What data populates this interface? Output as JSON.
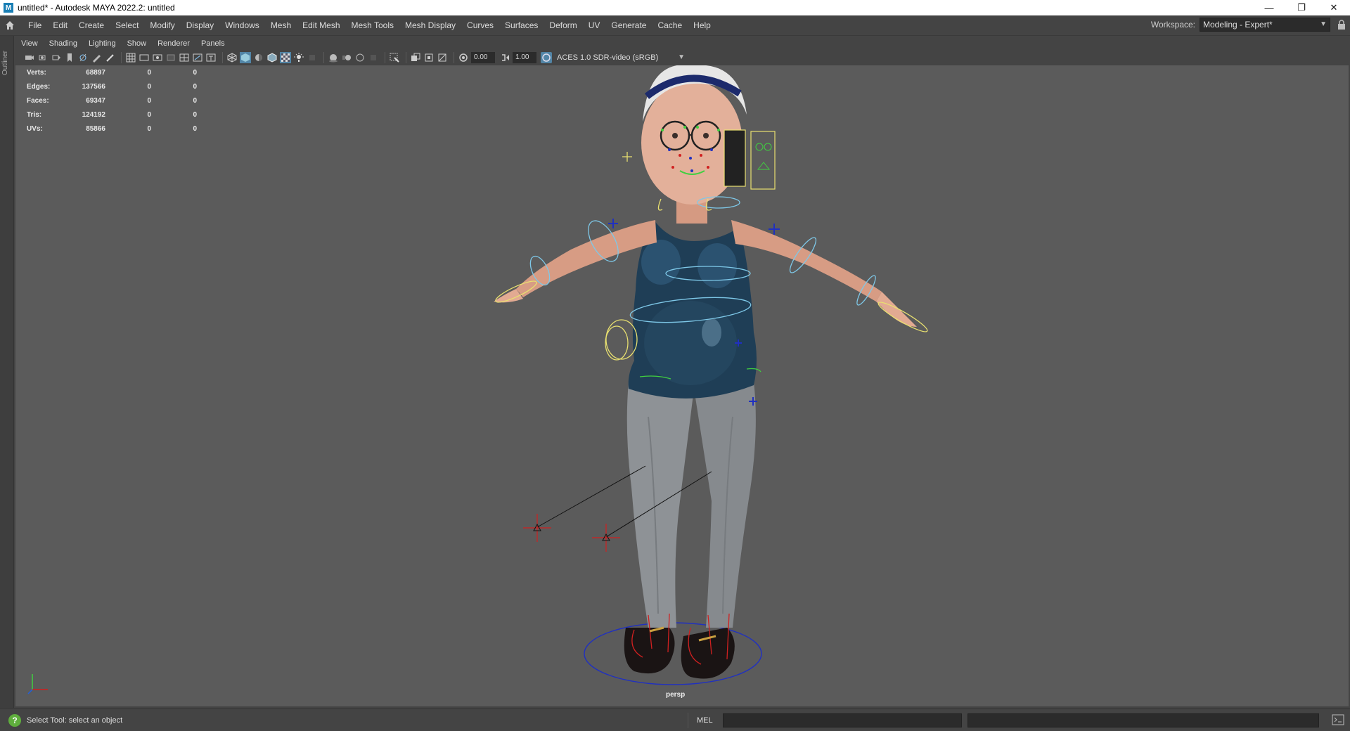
{
  "window": {
    "title": "untitled* - Autodesk MAYA 2022.2: untitled",
    "app_icon": "maya-icon",
    "controls": [
      "minimize-icon",
      "restore-icon",
      "close-icon"
    ]
  },
  "menubar": {
    "home_icon": "home-icon",
    "items": [
      "File",
      "Edit",
      "Create",
      "Select",
      "Modify",
      "Display",
      "Windows",
      "Mesh",
      "Edit Mesh",
      "Mesh Tools",
      "Mesh Display",
      "Curves",
      "Surfaces",
      "Deform",
      "UV",
      "Generate",
      "Cache",
      "Help"
    ],
    "workspace_label": "Workspace:",
    "workspace_value": "Modeling - Expert*"
  },
  "leftstrip": {
    "outliner_label": "Outliner"
  },
  "panel_menu": {
    "items": [
      "View",
      "Shading",
      "Lighting",
      "Show",
      "Renderer",
      "Panels"
    ]
  },
  "panel_toolbar": {
    "exposure": "0.00",
    "gamma": "1.00",
    "color_space": "ACES 1.0 SDR-video (sRGB)"
  },
  "hud": {
    "rows": [
      {
        "label": "Verts:",
        "v1": "68897",
        "v2": "0",
        "v3": "0"
      },
      {
        "label": "Edges:",
        "v1": "137566",
        "v2": "0",
        "v3": "0"
      },
      {
        "label": "Faces:",
        "v1": "69347",
        "v2": "0",
        "v3": "0"
      },
      {
        "label": "Tris:",
        "v1": "124192",
        "v2": "0",
        "v3": "0"
      },
      {
        "label": "UVs:",
        "v1": "85866",
        "v2": "0",
        "v3": "0"
      }
    ]
  },
  "viewport": {
    "camera": "persp"
  },
  "statusbar": {
    "help_text": "Select Tool: select an object",
    "command_language": "MEL"
  },
  "colors": {
    "ui_bg": "#444444",
    "viewport_bg": "#5b5b5b",
    "rig_cyan": "#7ec8e8",
    "rig_yellow": "#e8e070",
    "rig_green": "#40d040",
    "rig_red": "#d02020",
    "rig_blue": "#2030c0"
  }
}
